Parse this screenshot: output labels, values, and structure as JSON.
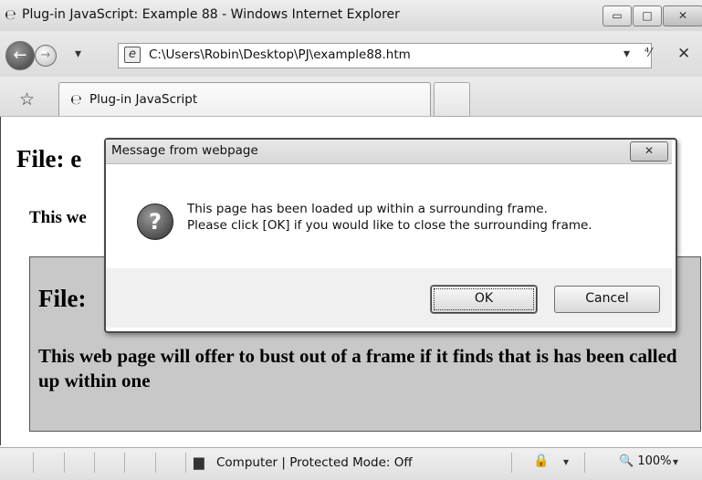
{
  "window": {
    "title": "Plug-in JavaScript: Example 88 - Windows Internet Explorer",
    "minimize_glyph": "▭",
    "maximize_glyph": "□",
    "close_glyph": "✕"
  },
  "navigation": {
    "address": "C:\\Users\\Robin\\Desktop\\PJ\\example88.htm",
    "back_glyph": "←",
    "forward_glyph": "→",
    "dropdown_glyph": "▾",
    "address_dropdown_glyph": "▾",
    "refresh_glyph": "⁴⁄",
    "stop_glyph": "✕"
  },
  "tabs": {
    "favorites_glyph": "☆",
    "active_label": "Plug-in JavaScript"
  },
  "page": {
    "heading_prefix": "File: e",
    "description_prefix": "This we",
    "frame_heading_prefix": "File:",
    "frame_description": "This web page will offer to bust out of a frame if it finds that is has been called up within one"
  },
  "dialog": {
    "title": "Message from webpage",
    "close_glyph": "✕",
    "icon_glyph": "?",
    "message_line1": "This page has been loaded up within a surrounding frame.",
    "message_line2": "Please click [OK] if you would like to close the surrounding frame.",
    "ok_label": "OK",
    "cancel_label": "Cancel"
  },
  "status": {
    "zone_text": "Computer | Protected Mode: Off",
    "zoom_text": "🔍 100%",
    "dropdown_glyph": "▾"
  }
}
